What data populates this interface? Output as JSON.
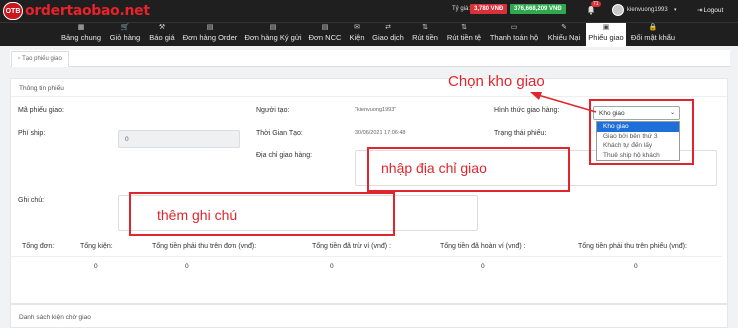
{
  "brand": {
    "badge": "OTB",
    "name": "ordertaobao.net"
  },
  "header": {
    "rate_label": "Tỷ giá:",
    "rate_value": "3,780 VNĐ",
    "balance": "376,668,209 VNĐ",
    "notif_count": "71",
    "username": "kienvuong1993",
    "logout": "Logout"
  },
  "nav": {
    "items": [
      {
        "label": "Bảng chung",
        "icon": "dashboard-icon"
      },
      {
        "label": "Giỏ hàng",
        "icon": "cart-icon"
      },
      {
        "label": "Báo giá",
        "icon": "wand-icon"
      },
      {
        "label": "Đơn hàng Order",
        "icon": "order-icon"
      },
      {
        "label": "Đơn hàng Ký gửi",
        "icon": "consign-icon"
      },
      {
        "label": "Đơn NCC",
        "icon": "supplier-icon"
      },
      {
        "label": "Kiện",
        "icon": "package-icon"
      },
      {
        "label": "Giao dịch",
        "icon": "transaction-icon"
      },
      {
        "label": "Rút tiền",
        "icon": "withdraw-icon"
      },
      {
        "label": "Rút tiền tệ",
        "icon": "exchange-icon"
      },
      {
        "label": "Thanh toán hộ",
        "icon": "payment-icon"
      },
      {
        "label": "Khiếu Nại",
        "icon": "complaint-icon"
      },
      {
        "label": "Phiếu giao",
        "icon": "delivery-slip-icon"
      },
      {
        "label": "Đổi mật khẩu",
        "icon": "lock-icon"
      }
    ],
    "active_index": 12
  },
  "tab": {
    "label": "Tạo phiếu giao"
  },
  "form": {
    "title": "Thông tin phiếu",
    "slip_code_label": "Mã phiếu giao:",
    "creator_label": "Người tạo:",
    "creator_value": "\"kienvuong1993\"",
    "method_label": "Hình thức giao hàng:",
    "method_value": "Kho giao",
    "method_options": [
      "Kho giao",
      "Giao bởi bên thứ 3",
      "Khách tự đến lấy",
      "Thuê ship hộ khách"
    ],
    "ship_fee_label": "Phí ship:",
    "ship_fee_value": "0",
    "created_time_label": "Thời Gian Tạo:",
    "created_time_value": "30/06/2021 17:06:48",
    "status_label": "Trạng thái phiếu:",
    "address_label": "Địa chỉ giao hàng:",
    "note_label": "Ghi chú:"
  },
  "summary": {
    "headers": [
      "Tổng đơn:",
      "Tổng kiện:",
      "Tổng tiền phải thu trên đơn (vnđ):",
      "Tổng tiền đã trừ ví (vnđ) :",
      "Tổng tiền đã hoàn ví (vnđ) :",
      "Tổng tiền phải thu trên phiếu (vnđ):"
    ],
    "values": [
      "0",
      "0",
      "0",
      "0",
      "0",
      "0"
    ]
  },
  "list_title": "Danh sách kiện chờ giao",
  "annotations": {
    "choose_warehouse": "Chọn kho giao",
    "enter_address": "nhập địa chỉ giao",
    "add_note": "thêm ghi chú"
  },
  "colors": {
    "accent": "#e0262c",
    "selected": "#1e6fd9",
    "header_bg": "#1f1f1f"
  }
}
